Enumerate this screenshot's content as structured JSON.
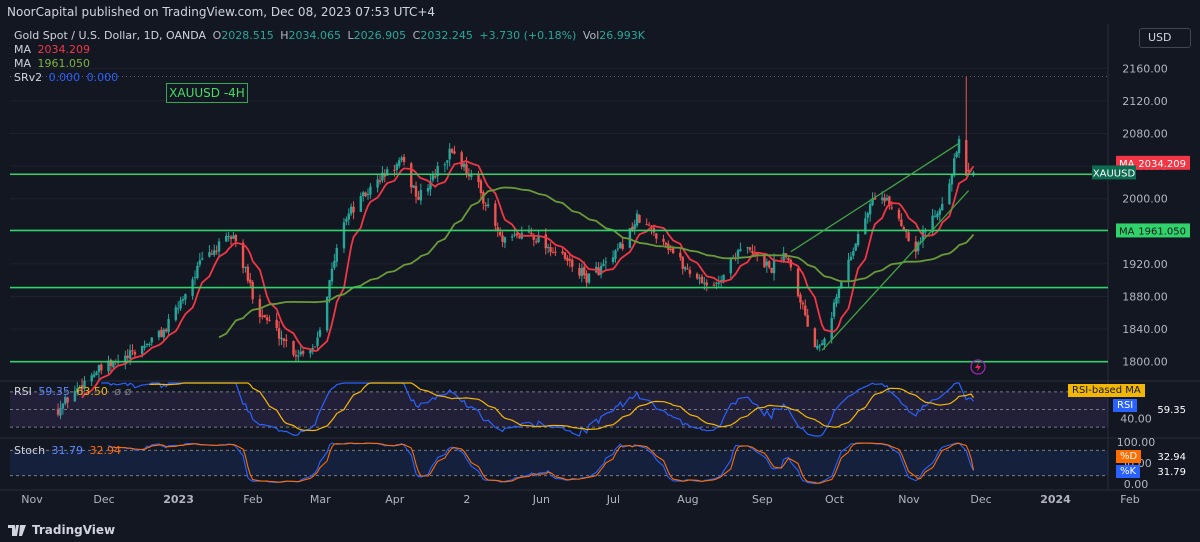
{
  "header": {
    "publisher_text": "NoorCapital published on TradingView.com, Dec 08, 2023 07:53 UTC+4"
  },
  "legend": {
    "symbol": "Gold Spot / U.S. Dollar, 1D, OANDA",
    "o_label": "O",
    "o": "2028.515",
    "h_label": "H",
    "h": "2034.065",
    "l_label": "L",
    "l": "2026.905",
    "c_label": "C",
    "c": "2032.245",
    "change": "+3.730 (+0.18%)",
    "vol_label": "Vol",
    "vol": "26.993K",
    "ma1_label": "MA",
    "ma1_value": "2034.209",
    "ma2_label": "MA",
    "ma2_value": "1961.050",
    "srv2_label": "SRv2",
    "srv2_v1": "0.000",
    "srv2_v2": "0.000"
  },
  "currency": "USD",
  "annotation": "XAUUSD -4H",
  "rsi": {
    "label": "RSI",
    "value": "59.35",
    "ma_value": "63.50",
    "extra": "ø ø",
    "ma_badge": "RSI-based MA",
    "rsi_badge": "RSI"
  },
  "stoch": {
    "label": "Stoch",
    "k": "31.79",
    "d": "32.94",
    "d_badge": "%D",
    "k_badge": "%K"
  },
  "footer": {
    "brand": "TradingView"
  },
  "colors": {
    "background": "#131722",
    "up": "#26a69a",
    "down": "#ef5350",
    "ma_fast": "#f23645",
    "ma_slow": "#6a9a3a",
    "level_line": "#2fd36a",
    "rsi_line": "#2962ff",
    "rsi_ma": "#f2b705",
    "stoch_k": "#2962ff",
    "stoch_d": "#ff6d00"
  },
  "chart_data": {
    "type": "candlestick",
    "price_axis": {
      "min": 1780,
      "max": 2180,
      "ticks": [
        1800,
        1840,
        1880,
        1920,
        1960,
        2000,
        2040,
        2080,
        2120,
        2160
      ]
    },
    "time_axis": [
      "Nov",
      "Dec",
      "2023",
      "Feb",
      "Mar",
      "Apr",
      "2",
      "Jun",
      "Jul",
      "Aug",
      "Sep",
      "Oct",
      "Nov",
      "Dec",
      "2024",
      "Feb"
    ],
    "last_price_label": "XAUUSD",
    "horizontal_levels": [
      2030,
      1961,
      1891,
      1800
    ],
    "price_path": [
      [
        "2022-11-21",
        1742
      ],
      [
        "2022-12-05",
        1785
      ],
      [
        "2022-12-20",
        1805
      ],
      [
        "2023-01-05",
        1840
      ],
      [
        "2023-01-20",
        1925
      ],
      [
        "2023-02-02",
        1955
      ],
      [
        "2023-02-12",
        1865
      ],
      [
        "2023-02-28",
        1810
      ],
      [
        "2023-03-08",
        1820
      ],
      [
        "2023-03-20",
        1975
      ],
      [
        "2023-04-04",
        2025
      ],
      [
        "2023-04-13",
        2045
      ],
      [
        "2023-04-20",
        2000
      ],
      [
        "2023-05-04",
        2060
      ],
      [
        "2023-05-15",
        2015
      ],
      [
        "2023-05-25",
        1945
      ],
      [
        "2023-06-05",
        1960
      ],
      [
        "2023-06-20",
        1925
      ],
      [
        "2023-06-29",
        1903
      ],
      [
        "2023-07-10",
        1925
      ],
      [
        "2023-07-20",
        1975
      ],
      [
        "2023-07-31",
        1950
      ],
      [
        "2023-08-09",
        1915
      ],
      [
        "2023-08-21",
        1890
      ],
      [
        "2023-09-01",
        1942
      ],
      [
        "2023-09-14",
        1915
      ],
      [
        "2023-09-20",
        1935
      ],
      [
        "2023-10-02",
        1820
      ],
      [
        "2023-10-06",
        1832
      ],
      [
        "2023-10-16",
        1925
      ],
      [
        "2023-10-27",
        2005
      ],
      [
        "2023-11-03",
        1990
      ],
      [
        "2023-11-13",
        1940
      ],
      [
        "2023-11-27",
        2015
      ],
      [
        "2023-12-01",
        2072
      ],
      [
        "2023-12-04",
        2030
      ],
      [
        "2023-12-07",
        2032
      ]
    ],
    "spike": {
      "date": "2023-12-04",
      "high": 2150
    },
    "ma_fast_last": 2034.209,
    "ma_slow_last": 1961.05,
    "rsi_axis": {
      "min": 20,
      "max": 80,
      "ticks": [
        40
      ]
    },
    "rsi_last": 59.35,
    "rsi_ma_last": 63.5,
    "stoch_axis": {
      "min": 0,
      "max": 100,
      "ticks": [
        0,
        50,
        100
      ],
      "tick_labels": [
        "0.00",
        "50.00",
        "100.00"
      ]
    },
    "stoch_k_last": 31.79,
    "stoch_d_last": 32.94,
    "ma1_axis_label": "MA",
    "ma1_axis_value": "2034.209",
    "ma2_axis_label": "MA",
    "ma2_axis_value": "1961.050",
    "rsi_ma_badge_value": "63.50",
    "rsi_badge_value": "59.35",
    "stoch_d_badge_value": "32.94",
    "stoch_k_badge_value": "31.79"
  }
}
